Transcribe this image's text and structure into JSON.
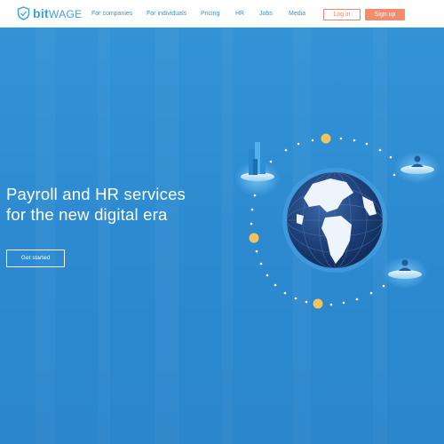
{
  "brand": {
    "name_bold": "bit",
    "name_rest": "WAGE"
  },
  "nav": {
    "items": [
      {
        "label": "For companies"
      },
      {
        "label": "For individuals"
      },
      {
        "label": "Pricing"
      },
      {
        "label": "HR"
      },
      {
        "label": "Jobs"
      },
      {
        "label": "Media"
      }
    ],
    "login_label": "Log in",
    "signup_label": "Sign up"
  },
  "hero": {
    "headline_line1": "Payroll and HR services",
    "headline_line2": "for the new digital era",
    "cta_label": "Get started"
  },
  "colors": {
    "brand": "#3ba0e0",
    "accent": "#f68a6b",
    "hero_bg": "#2f8fd3",
    "coin": "#f2c35a"
  },
  "icons": [
    "shield-logo-icon",
    "globe-icon",
    "buildings-icon",
    "user-icon",
    "coin-icon"
  ]
}
